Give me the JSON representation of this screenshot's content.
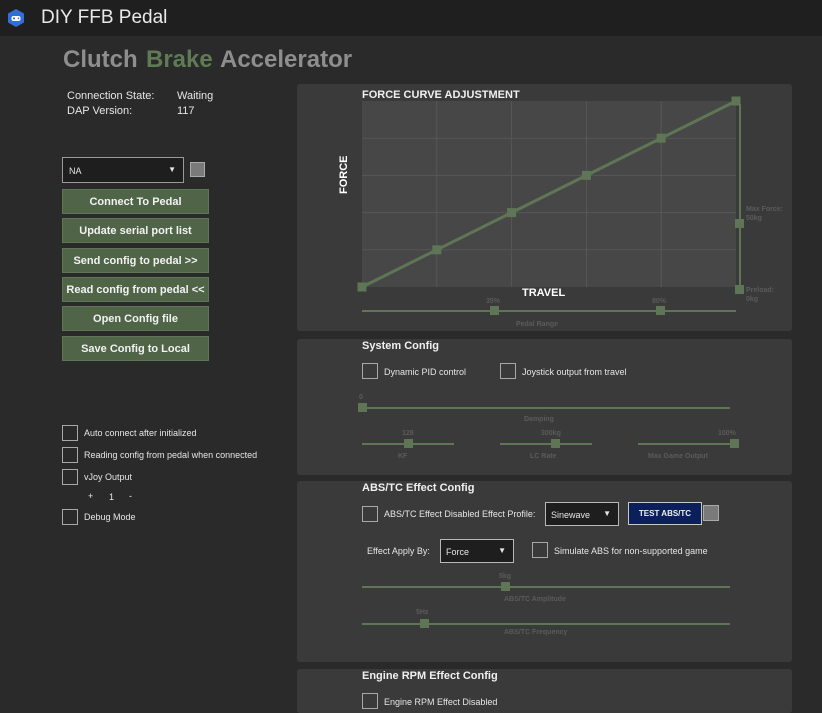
{
  "app": {
    "title": "DIY FFB Pedal"
  },
  "tabs": [
    "Clutch",
    "Brake",
    "Accelerator"
  ],
  "connection": {
    "state_label": "Connection State:",
    "state_value": "Waiting",
    "dap_label": "DAP Version:",
    "dap_value": "117"
  },
  "serial_port": {
    "selected": "NA"
  },
  "buttons": {
    "connect": "Connect To Pedal",
    "update": "Update serial port list",
    "send": "Send config to pedal >>",
    "read": "Read config from pedal <<",
    "open": "Open Config file",
    "save": "Save Config to Local"
  },
  "options": {
    "auto_connect": "Auto connect after initialized",
    "reading_config": "Reading config from pedal when connected",
    "vjoy": "vJoy Output",
    "vjoy_plus": "+",
    "vjoy_value": "1",
    "vjoy_minus": "-",
    "debug": "Debug Mode"
  },
  "force_curve": {
    "title": "FORCE CURVE ADJUSTMENT",
    "y_label": "FORCE",
    "x_label": "TRAVEL",
    "max_force_label": "Max Force:",
    "max_force_value": "50kg",
    "preload_label": "Preload:",
    "preload_value": "0kg",
    "range_min": "35%",
    "range_max": "80%",
    "range_label": "Pedal Range"
  },
  "chart_data": {
    "type": "line",
    "x": [
      0,
      20,
      40,
      60,
      80,
      100
    ],
    "y": [
      0,
      20,
      40,
      60,
      80,
      100
    ],
    "title": "FORCE CURVE ADJUSTMENT",
    "xlabel": "TRAVEL",
    "ylabel": "FORCE",
    "xlim": [
      0,
      100
    ],
    "ylim": [
      0,
      100
    ],
    "grid": true
  },
  "system_config": {
    "title": "System Config",
    "dynamic_pid": "Dynamic PID control",
    "joystick_travel": "Joystick output from travel",
    "damping_value": "0",
    "damping_label": "Damping",
    "kf_value": "128",
    "kf_label": "KF",
    "lc_value": "300kg",
    "lc_label": "LC Rate",
    "max_game_value": "100%",
    "max_game_label": "Max Game Output",
    "damping_level": 0,
    "kf_level": 0.5,
    "lc_level": 0.6,
    "max_game_level": 1.0
  },
  "abs_config": {
    "title": "ABS/TC Effect Config",
    "disabled_label": "ABS/TC Effect Disabled",
    "profile_label": "Effect Profile:",
    "profile_value": "Sinewave",
    "test_button": "TEST ABS/TC",
    "apply_label": "Effect Apply By:",
    "apply_value": "Force",
    "simulate_label": "Simulate ABS for non-supported game",
    "amplitude_value": "5kg",
    "amplitude_label": "ABS/TC Amplitude",
    "frequency_value": "5Hz",
    "frequency_label": "ABS/TC Frequency",
    "amplitude_level": 0.39,
    "frequency_level": 0.17
  },
  "rpm_config": {
    "title": "Engine RPM Effect Config",
    "disabled_label": "Engine RPM Effect Disabled"
  },
  "colors": {
    "accent": "#5f7a55",
    "button_green": "#506548",
    "panel": "#3a3a3a",
    "test_button": "#0b1f5a"
  }
}
